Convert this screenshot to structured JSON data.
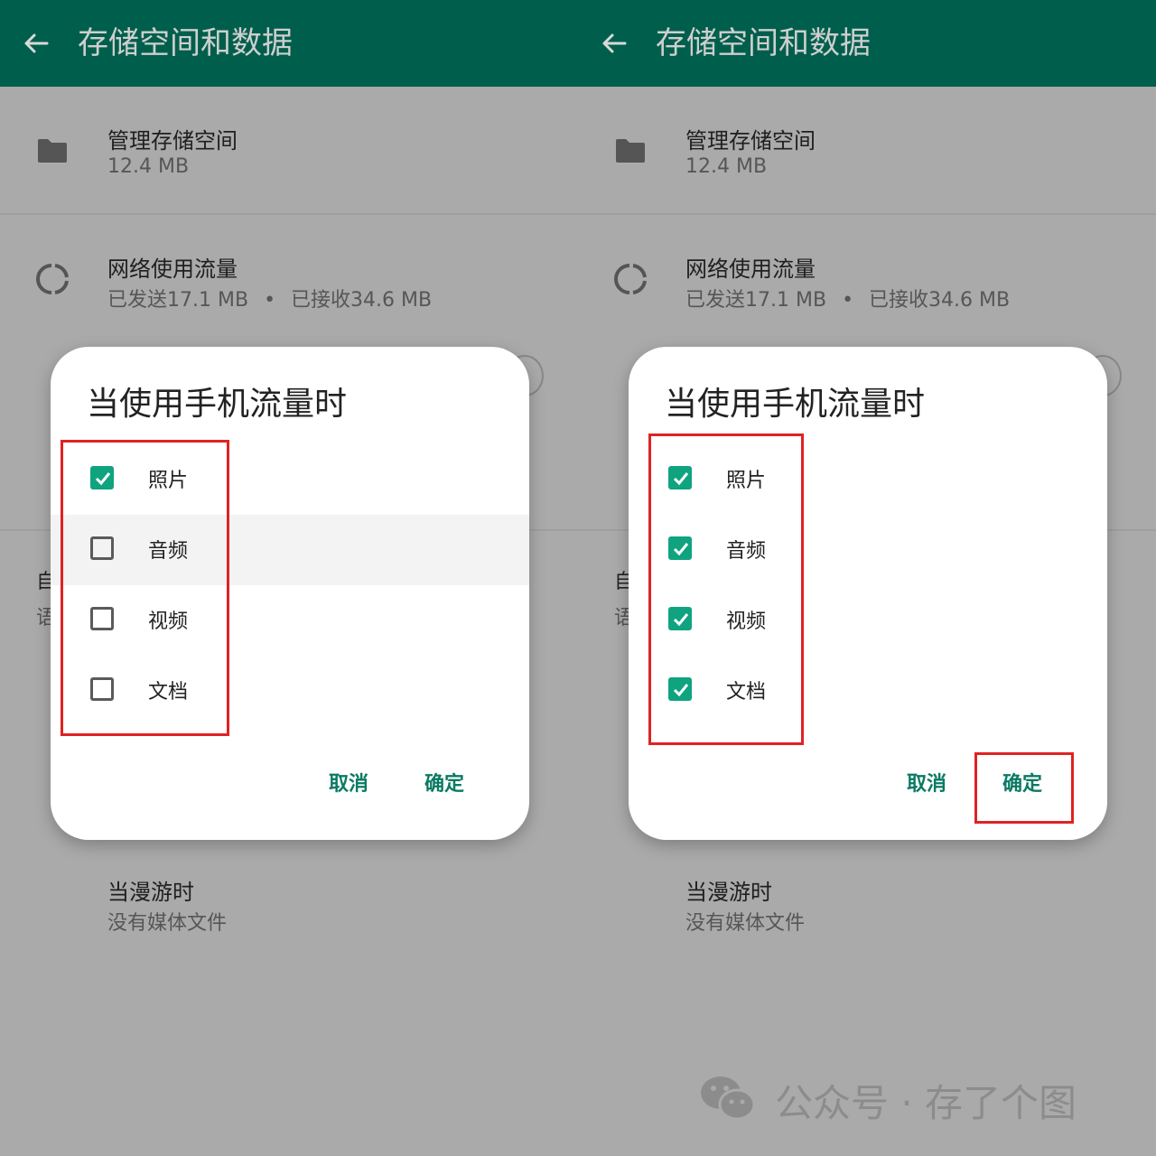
{
  "colors": {
    "appbar": "#005f4c",
    "accent": "#10a37f",
    "button": "#0b7a63",
    "highlight_box": "#e02222",
    "scrim": "#aaaaaa"
  },
  "appbar": {
    "title": "存储空间和数据",
    "back_icon": "arrow-left-icon"
  },
  "settings": {
    "manage_storage": {
      "title": "管理存储空间",
      "size": "12.4 MB",
      "icon": "folder-icon"
    },
    "network_usage": {
      "title": "网络使用流量",
      "sent": "已发送17.1 MB",
      "separator": "•",
      "received": "已接收34.6 MB",
      "icon": "data-usage-icon"
    },
    "partial_heading": "自",
    "partial_sub": "语",
    "roaming": {
      "title": "当漫游时",
      "value": "没有媒体文件"
    }
  },
  "dialog_left": {
    "title": "当使用手机流量时",
    "options": [
      {
        "label": "照片",
        "checked": true
      },
      {
        "label": "音频",
        "checked": false
      },
      {
        "label": "视频",
        "checked": false
      },
      {
        "label": "文档",
        "checked": false
      }
    ],
    "cancel": "取消",
    "ok": "确定"
  },
  "dialog_right": {
    "title": "当使用手机流量时",
    "options": [
      {
        "label": "照片",
        "checked": true
      },
      {
        "label": "音频",
        "checked": true
      },
      {
        "label": "视频",
        "checked": true
      },
      {
        "label": "文档",
        "checked": true
      }
    ],
    "cancel": "取消",
    "ok": "确定"
  },
  "watermark": {
    "text": "公众号 · 存了个图",
    "icon": "wechat-icon"
  }
}
